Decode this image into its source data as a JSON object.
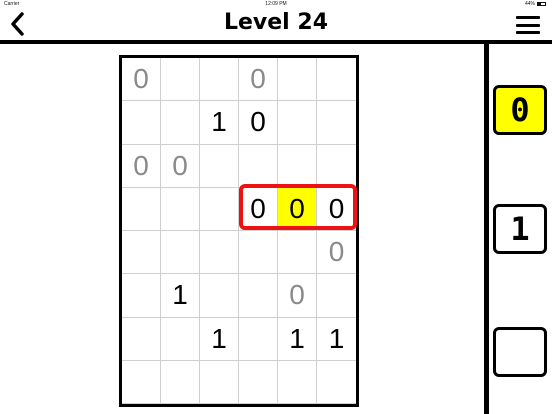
{
  "status": {
    "carrier": "Carrier",
    "time": "12:09 PM",
    "battery": "44%"
  },
  "header": {
    "title": "Level 24"
  },
  "grid": {
    "rows": [
      [
        {
          "v": "0",
          "kind": "given"
        },
        {
          "v": "",
          "kind": "empty"
        },
        {
          "v": "",
          "kind": "empty"
        },
        {
          "v": "0",
          "kind": "given"
        },
        {
          "v": "",
          "kind": "empty"
        },
        {
          "v": "",
          "kind": "empty"
        }
      ],
      [
        {
          "v": "",
          "kind": "empty"
        },
        {
          "v": "",
          "kind": "empty"
        },
        {
          "v": "1",
          "kind": "user"
        },
        {
          "v": "0",
          "kind": "user"
        },
        {
          "v": "",
          "kind": "empty"
        },
        {
          "v": "",
          "kind": "empty"
        }
      ],
      [
        {
          "v": "0",
          "kind": "given"
        },
        {
          "v": "0",
          "kind": "given"
        },
        {
          "v": "",
          "kind": "empty"
        },
        {
          "v": "",
          "kind": "empty"
        },
        {
          "v": "",
          "kind": "empty"
        },
        {
          "v": "",
          "kind": "empty"
        }
      ],
      [
        {
          "v": "",
          "kind": "empty"
        },
        {
          "v": "",
          "kind": "empty"
        },
        {
          "v": "",
          "kind": "empty"
        },
        {
          "v": "0",
          "kind": "user"
        },
        {
          "v": "0",
          "kind": "user",
          "highlight": true
        },
        {
          "v": "0",
          "kind": "user"
        }
      ],
      [
        {
          "v": "",
          "kind": "empty"
        },
        {
          "v": "",
          "kind": "empty"
        },
        {
          "v": "",
          "kind": "empty"
        },
        {
          "v": "",
          "kind": "empty"
        },
        {
          "v": "",
          "kind": "empty"
        },
        {
          "v": "0",
          "kind": "given"
        }
      ],
      [
        {
          "v": "",
          "kind": "empty"
        },
        {
          "v": "1",
          "kind": "user"
        },
        {
          "v": "",
          "kind": "empty"
        },
        {
          "v": "",
          "kind": "empty"
        },
        {
          "v": "0",
          "kind": "given"
        },
        {
          "v": "",
          "kind": "empty"
        }
      ],
      [
        {
          "v": "",
          "kind": "empty"
        },
        {
          "v": "",
          "kind": "empty"
        },
        {
          "v": "1",
          "kind": "user"
        },
        {
          "v": "",
          "kind": "empty"
        },
        {
          "v": "1",
          "kind": "user"
        },
        {
          "v": "1",
          "kind": "user"
        }
      ],
      [
        {
          "v": "",
          "kind": "empty"
        },
        {
          "v": "",
          "kind": "empty"
        },
        {
          "v": "",
          "kind": "empty"
        },
        {
          "v": "",
          "kind": "empty"
        },
        {
          "v": "",
          "kind": "empty"
        },
        {
          "v": "",
          "kind": "empty"
        }
      ]
    ]
  },
  "tools": [
    {
      "label": "0",
      "selected": true
    },
    {
      "label": "1",
      "selected": false
    },
    {
      "label": "",
      "selected": false
    }
  ],
  "colors": {
    "highlight": "#ffff00",
    "error": "#ee1111",
    "given_text": "#8a8a8a"
  }
}
